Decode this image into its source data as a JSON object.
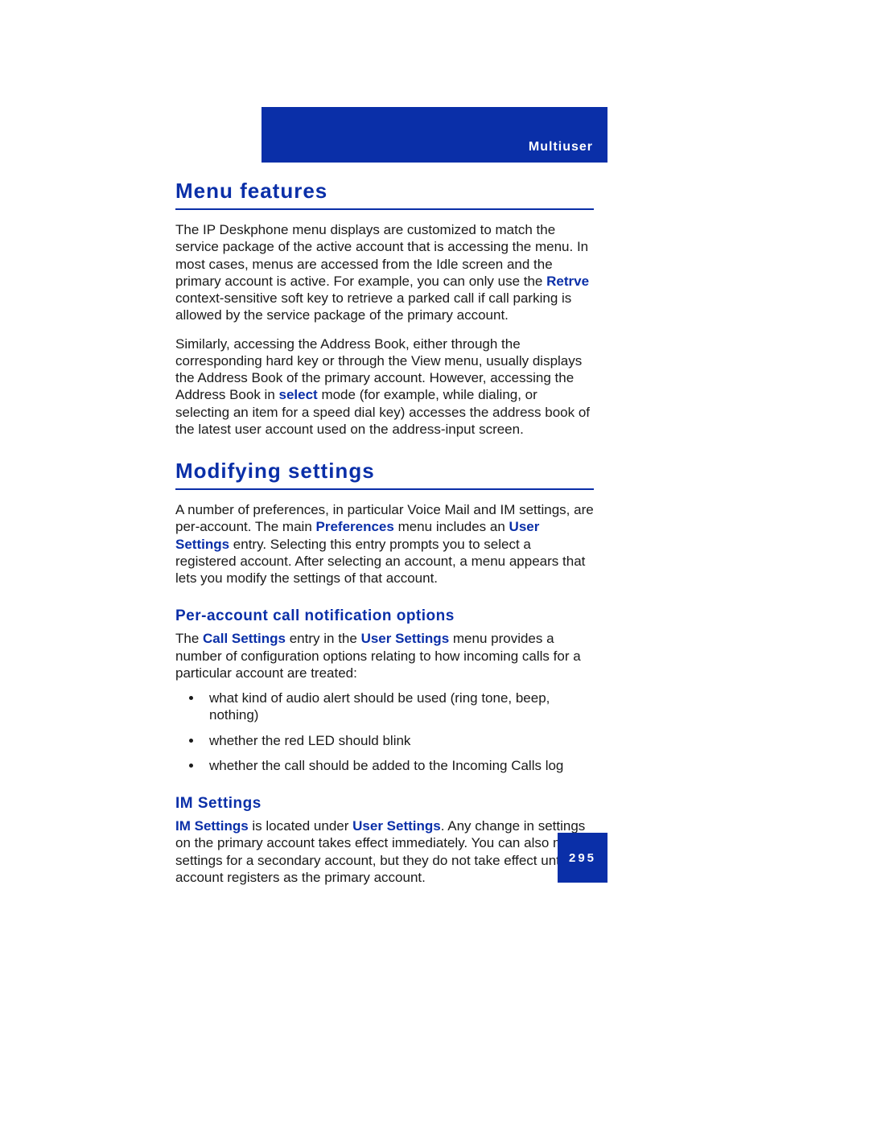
{
  "header": {
    "section_label": "Multiuser"
  },
  "sections": {
    "menu_features": {
      "title": "Menu features",
      "p1_a": "The IP Deskphone menu displays are customized to match the service package of the active account that is accessing the menu. In most cases, menus are accessed from the Idle screen and the primary account is active. For example, you can only use the ",
      "p1_bold": "Retrve",
      "p1_b": " context-sensitive soft key to retrieve a parked call if call parking is allowed by the service package of the primary account.",
      "p2_a": "Similarly, accessing the Address Book, either through the corresponding hard key or through the View menu, usually displays the Address Book of the primary account. However, accessing the Address Book in ",
      "p2_bold": "select",
      "p2_b": " mode (for example, while dialing, or selecting an item for a speed dial key) accesses the address book of the latest user account used on the address-input screen."
    },
    "modifying_settings": {
      "title": "Modifying settings",
      "p1_a": "A number of preferences, in particular Voice Mail and IM settings, are per-account. The main ",
      "p1_bold1": "Preferences",
      "p1_mid": " menu includes an ",
      "p1_bold2": "User Settings",
      "p1_b": " entry. Selecting this entry prompts you to select a registered account. After selecting an account, a menu appears that lets you modify the settings of that account.",
      "sub_peraccount": {
        "title": "Per-account call notification options",
        "p_a": "The ",
        "p_bold1": "Call Settings",
        "p_mid": " entry in the ",
        "p_bold2": "User Settings",
        "p_b": " menu provides a number of configuration options relating to how incoming calls for a particular account are treated:",
        "bullets": [
          "what kind of audio alert should be used (ring tone, beep, nothing)",
          "whether the red LED should blink",
          "whether the call should be added to the Incoming Calls log"
        ]
      },
      "sub_im": {
        "title": "IM Settings",
        "p_bold1": "IM Settings",
        "p_mid1": " is located under ",
        "p_bold2": "User Settings",
        "p_b": ". Any change in settings on the primary account takes effect immediately. You can also modify settings for a secondary account, but they do not take effect until that account registers as the primary account."
      }
    }
  },
  "page_number": "295"
}
